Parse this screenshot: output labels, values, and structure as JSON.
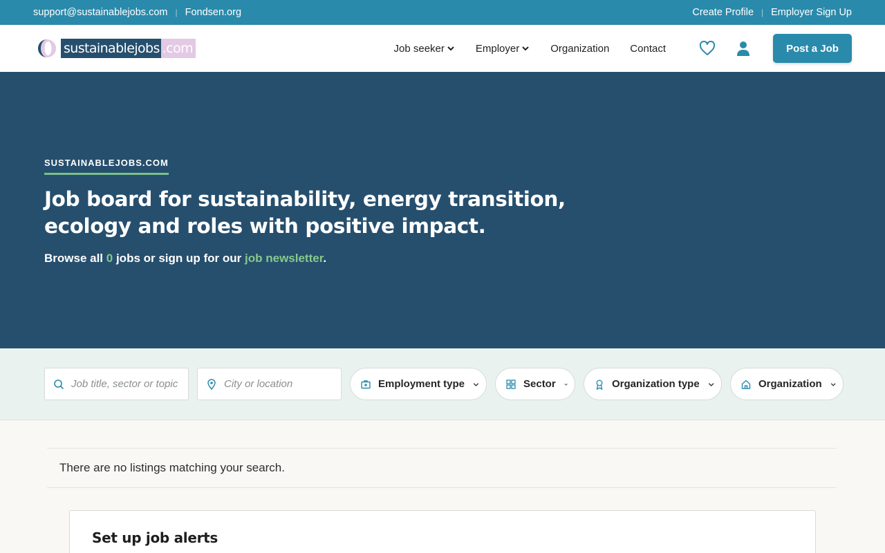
{
  "topbar": {
    "email": "support@sustainablejobs.com",
    "partner": "Fondsen.org",
    "create_profile": "Create Profile",
    "employer_signup": "Employer Sign Up",
    "separator": "|"
  },
  "header": {
    "logo_main": "sustainablejobs",
    "logo_tld": ".com",
    "nav": {
      "job_seeker": "Job seeker",
      "employer": "Employer",
      "organization": "Organization",
      "contact": "Contact"
    },
    "post_job": "Post a Job",
    "icons": [
      "heart-icon",
      "user-icon",
      "chevron-down-icon"
    ]
  },
  "hero": {
    "eyebrow": "SUSTAINABLEJOBS.COM",
    "title": "Job board for sustainability, energy transition, ecology and roles with positive impact.",
    "sub_prefix": "Browse all ",
    "job_count": "0",
    "sub_middle": " jobs or sign up for our ",
    "newsletter_link": "job newsletter",
    "sub_suffix": "."
  },
  "filters": {
    "search_placeholder": "Job title, sector or topic",
    "location_placeholder": "City or location",
    "employment_type": "Employment type",
    "sector": "Sector",
    "organization_type": "Organization type",
    "organization": "Organization"
  },
  "results": {
    "empty_message": "There are no listings matching your search."
  },
  "alerts": {
    "title": "Set up job alerts"
  },
  "colors": {
    "primary": "#2a8aab",
    "hero_bg": "#264f6e",
    "accent_green": "#86c98b",
    "filter_bg": "#e9f2ef"
  }
}
